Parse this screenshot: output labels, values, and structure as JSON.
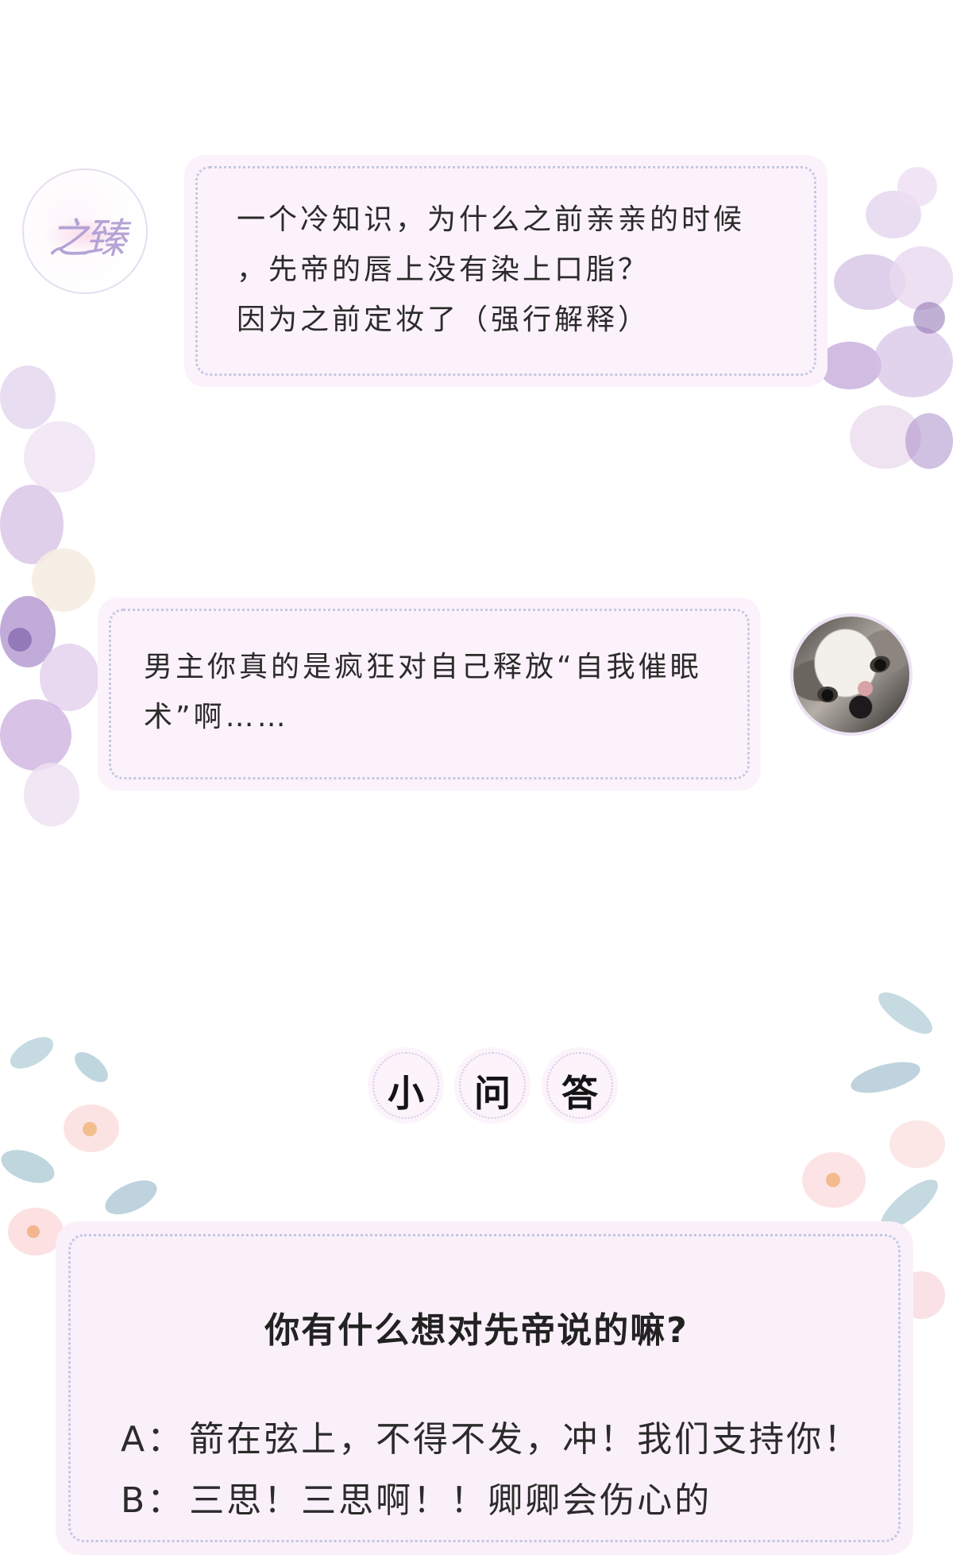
{
  "bubble_1": {
    "avatar_logo_text": "之臻",
    "lines": [
      "一个冷知识，为什么之前亲亲的时候",
      "，先帝的唇上没有染上口脂？",
      "因为之前定妆了（强行解释）"
    ]
  },
  "bubble_2": {
    "lines": [
      "男主你真的是疯狂对自己释放“自我催眠",
      "术”啊……"
    ]
  },
  "qa": {
    "heading_chars": [
      "小",
      "问",
      "答"
    ],
    "question": "你有什么想对先帝说的嘛?",
    "options": [
      {
        "letter": "A：",
        "text": "箭在弦上，不得不发，冲！我们支持你！"
      },
      {
        "letter": "B：",
        "text": "三思！三思啊！！卿卿会伤心的"
      }
    ]
  },
  "colors": {
    "bubble_bg": "#fcf2fb",
    "bubble_border": "#c5c8e2",
    "accent_purple": "#b3a3d6",
    "accent_pink": "#f3c4d9"
  }
}
